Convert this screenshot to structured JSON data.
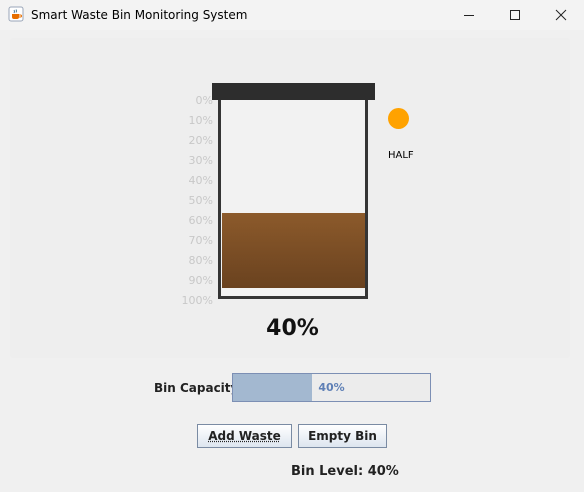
{
  "window": {
    "title": "Smart Waste Bin Monitoring System",
    "icon": "java-cup-icon"
  },
  "bin": {
    "scale_labels": [
      "0%",
      "10%",
      "20%",
      "30%",
      "40%",
      "50%",
      "60%",
      "70%",
      "80%",
      "90%",
      "100%"
    ],
    "fill_fraction": 0.4,
    "fill_color": "#7a4d25",
    "lid_color": "#2d2d2d",
    "percent_text": "40%"
  },
  "status": {
    "label": "HALF",
    "color": "#ffa200"
  },
  "capacity": {
    "label": "Bin Capacity:",
    "value": 40,
    "text": "40%"
  },
  "buttons": {
    "add_label": "Add Waste",
    "empty_label": "Empty Bin"
  },
  "level_text": "Bin Level: 40%"
}
